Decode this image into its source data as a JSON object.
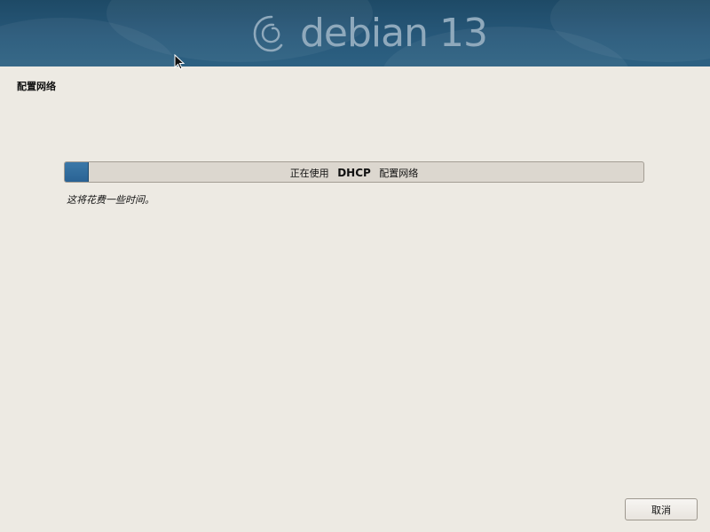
{
  "banner": {
    "logo_text": "debian 13",
    "logo_icon": "debian-swirl-icon"
  },
  "step": {
    "title": "配置网络"
  },
  "progress": {
    "prefix": "正在使用",
    "protocol": "DHCP",
    "suffix": "配置网络",
    "fraction": 0.04,
    "fill_color": "#2f6a9c"
  },
  "hint": "这将花费一些时间。",
  "buttons": {
    "cancel_label": "取消"
  },
  "colors": {
    "background": "#edeae3",
    "banner": "#234f6d"
  }
}
